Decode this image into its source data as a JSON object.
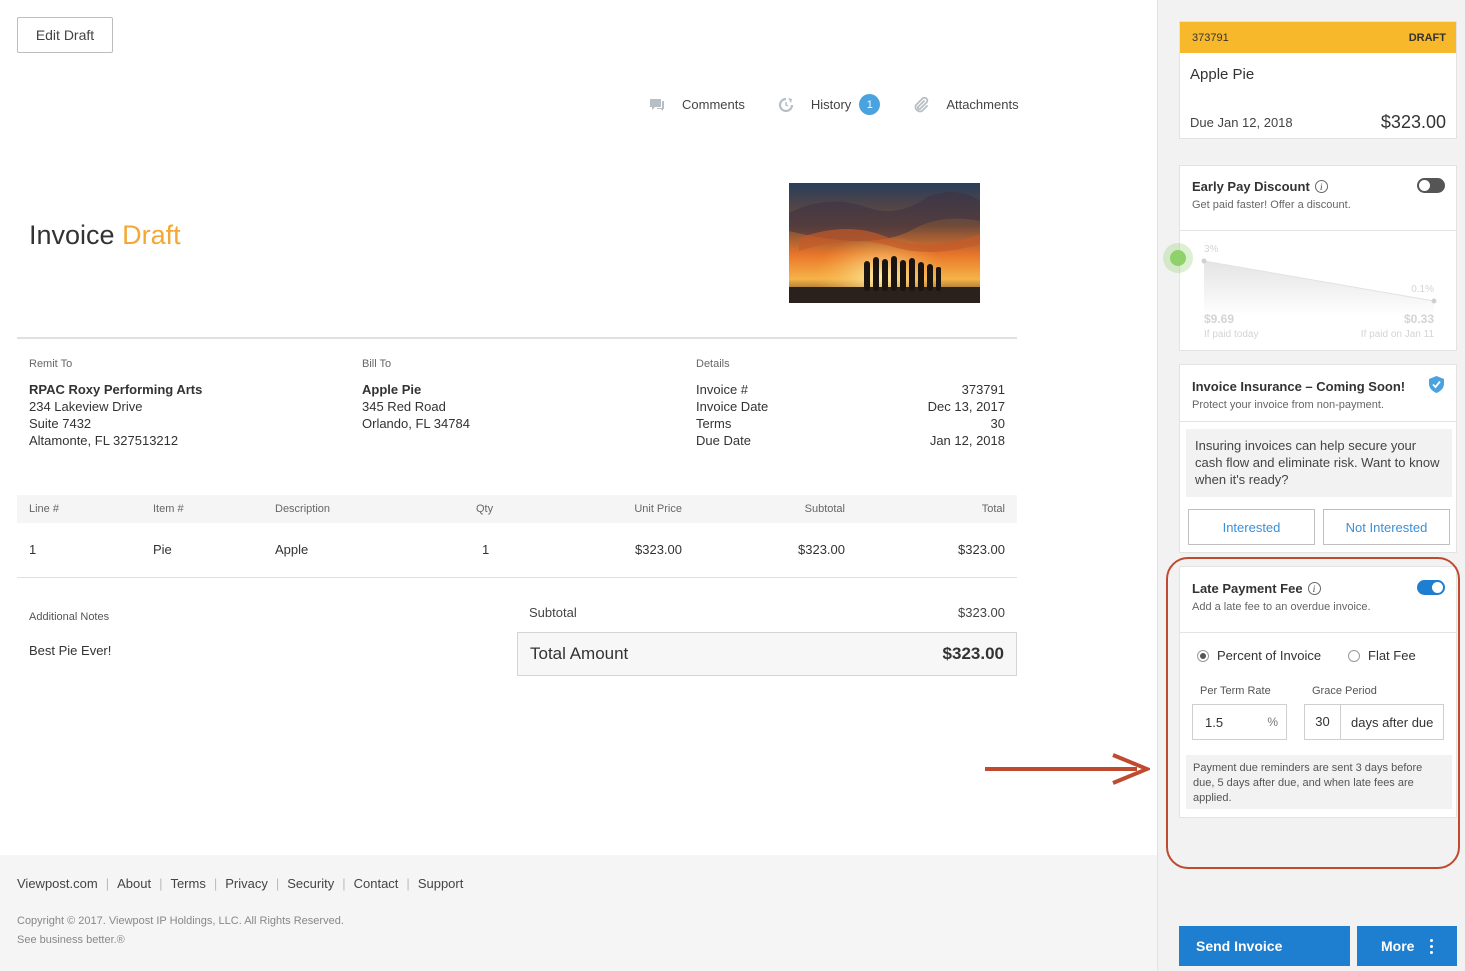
{
  "header": {
    "edit_draft": "Edit Draft"
  },
  "toolbar": {
    "comments": "Comments",
    "history": "History",
    "history_count": "1",
    "attachments": "Attachments"
  },
  "title": {
    "main": "Invoice",
    "status": "Draft"
  },
  "remit": {
    "label": "Remit To",
    "name": "RPAC Roxy Performing Arts",
    "line1": "234 Lakeview Drive",
    "line2": "Suite 7432",
    "line3": "Altamonte, FL 327513212"
  },
  "bill": {
    "label": "Bill To",
    "name": "Apple Pie",
    "line1": "345 Red Road",
    "line2": "Orlando, FL 34784"
  },
  "details": {
    "label": "Details",
    "rows": [
      {
        "k": "Invoice #",
        "v": "373791"
      },
      {
        "k": "Invoice Date",
        "v": "Dec 13, 2017"
      },
      {
        "k": "Terms",
        "v": "30"
      },
      {
        "k": "Due Date",
        "v": "Jan 12, 2018"
      }
    ]
  },
  "table": {
    "headers": [
      "Line #",
      "Item #",
      "Description",
      "Qty",
      "Unit Price",
      "Subtotal",
      "Total"
    ],
    "rows": [
      [
        "1",
        "Pie",
        "Apple",
        "1",
        "$323.00",
        "$323.00",
        "$323.00"
      ]
    ]
  },
  "notes": {
    "label": "Additional Notes",
    "value": "Best Pie Ever!"
  },
  "totals": {
    "subtotal_label": "Subtotal",
    "subtotal": "$323.00",
    "total_label": "Total Amount",
    "total": "$323.00"
  },
  "footer": {
    "links": [
      "Viewpost.com",
      "About",
      "Terms",
      "Privacy",
      "Security",
      "Contact",
      "Support"
    ],
    "copyright": "Copyright © 2017. Viewpost IP Holdings, LLC. All Rights Reserved.",
    "tagline": "See business better.®"
  },
  "sidebar": {
    "invoice_card": {
      "number": "373791",
      "status": "DRAFT",
      "customer": "Apple Pie",
      "due": "Due Jan 12, 2018",
      "amount": "$323.00"
    },
    "early_pay": {
      "title": "Early Pay Discount",
      "subtitle": "Get paid faster! Offer a discount.",
      "enabled": false,
      "start_pct": "3%",
      "end_pct": "0.1%",
      "start_amt": "$9.69",
      "end_amt": "$0.33",
      "start_caption": "If paid today",
      "end_caption": "If paid on Jan 11"
    },
    "insurance": {
      "title": "Invoice Insurance – Coming Soon!",
      "subtitle": "Protect your invoice from non-payment.",
      "message": "Insuring invoices can help secure your cash flow and eliminate risk. Want to know when it's ready?",
      "interested": "Interested",
      "not_interested": "Not Interested"
    },
    "late_fee": {
      "title": "Late Payment Fee",
      "subtitle": "Add a late fee to an overdue invoice.",
      "enabled": true,
      "option_percent": "Percent of Invoice",
      "option_flat": "Flat Fee",
      "rate_label": "Per Term Rate",
      "rate_value": "1.5",
      "rate_unit": "%",
      "grace_label": "Grace Period",
      "grace_value": "30",
      "grace_unit": "days after due",
      "message": "Payment due reminders are sent 3 days before due, 5 days after due, and when late fees are applied."
    },
    "send_invoice": "Send Invoice",
    "more": "More"
  },
  "colors": {
    "accent": "#1e7fd0",
    "draft": "#f4a833",
    "highlight": "#bf4a2f",
    "card_header": "#f8b82b"
  }
}
